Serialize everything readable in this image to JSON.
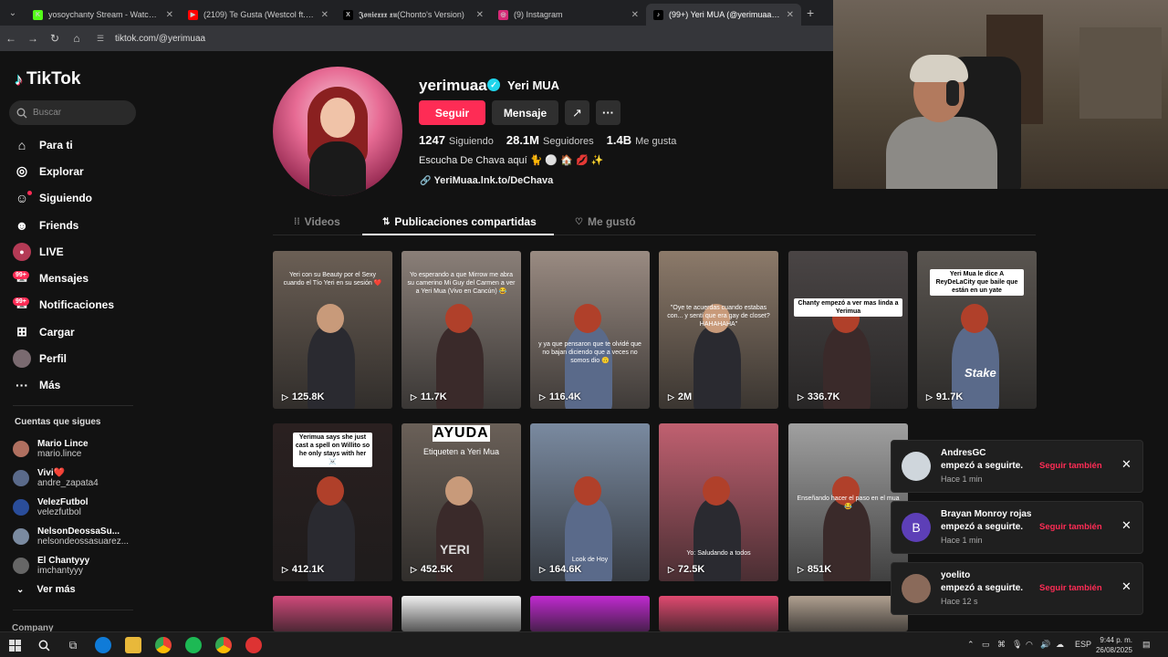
{
  "browser": {
    "tabs": [
      {
        "title": "yosoychanty Stream - Watch Li...",
        "favicon_color": "#53fc18",
        "favicon_text": "K"
      },
      {
        "title": "(2109) Te Gusta (Westcol ft. Le...",
        "favicon_color": "#ff0000",
        "favicon_text": "▶"
      },
      {
        "title": "𝕵𝖔𝖓𝖎𝖊𝖝𝖝𝖝 𝖝𝖚(Chonto's Version)",
        "favicon_color": "#000000",
        "favicon_text": "X"
      },
      {
        "title": "(9) Instagram",
        "favicon_color": "#d62976",
        "favicon_text": "◎"
      },
      {
        "title": "(99+) Yeri MUA (@yerimuaa) of...",
        "favicon_color": "#000000",
        "favicon_text": "♪"
      }
    ],
    "url": "tiktok.com/@yerimuaa"
  },
  "sidebar": {
    "logo": "TikTok",
    "search_placeholder": "Buscar",
    "items": [
      {
        "label": "Para ti",
        "icon": "home-icon",
        "glyph": "⌂"
      },
      {
        "label": "Explorar",
        "icon": "compass-icon",
        "glyph": "◎"
      },
      {
        "label": "Siguiendo",
        "icon": "following-icon",
        "glyph": "☺"
      },
      {
        "label": "Friends",
        "icon": "friends-icon",
        "glyph": "☻"
      },
      {
        "label": "LIVE",
        "icon": "live-icon",
        "glyph": "●"
      },
      {
        "label": "Mensajes",
        "icon": "messages-icon",
        "glyph": "✉",
        "badge": "99+"
      },
      {
        "label": "Notificaciones",
        "icon": "notifications-icon",
        "glyph": "✉",
        "badge": "99+"
      },
      {
        "label": "Cargar",
        "icon": "upload-icon",
        "glyph": "⊞"
      },
      {
        "label": "Perfil",
        "icon": "profile-icon",
        "glyph": "●"
      },
      {
        "label": "Más",
        "icon": "more-icon",
        "glyph": "···"
      }
    ],
    "follows_title": "Cuentas que sigues",
    "follows": [
      {
        "name": "Mario Lince",
        "user": "mario.lince",
        "color": "#b07060"
      },
      {
        "name": "Vivi❤️",
        "user": "andre_zapata4",
        "color": "#5a6a8a"
      },
      {
        "name": "VelezFutbol",
        "user": "velezfutbol",
        "color": "#2a4d9a"
      },
      {
        "name": "NelsonDeossaSu...",
        "user": "nelsondeossasuarez...",
        "color": "#7a8aa0"
      },
      {
        "name": "El Chantyyy",
        "user": "imchantyyy",
        "color": "#666666"
      }
    ],
    "see_more": "Ver más",
    "company": "Company"
  },
  "profile": {
    "username": "yerimuaa",
    "display_name": "Yeri MUA",
    "follow_label": "Seguir",
    "message_label": "Mensaje",
    "stats": [
      {
        "value": "1247",
        "label": "Siguiendo"
      },
      {
        "value": "28.1M",
        "label": "Seguidores"
      },
      {
        "value": "1.4B",
        "label": "Me gusta"
      }
    ],
    "bio": "Escucha De Chava aquí 🐈 ⚪ 🏠 💋 ✨",
    "link": "YeriMuaa.lnk.to/DeChava"
  },
  "tabs": [
    {
      "label": "Videos",
      "icon": "grid-icon",
      "glyph": "⁞⁞"
    },
    {
      "label": "Publicaciones compartidas",
      "icon": "repost-icon",
      "glyph": "⇅"
    },
    {
      "label": "Me gustó",
      "icon": "like-hidden-icon",
      "glyph": "♡"
    }
  ],
  "videos": [
    {
      "views": "125.8K",
      "bg": "#6b5f55",
      "caption": "Yeri con su Beauty por el Sexy cuando el Tío Yeri en su sesión ❤️"
    },
    {
      "views": "11.7K",
      "bg": "#8a7f78",
      "caption": "Yo esperando a que Mirrow me abra su camerino Mi Guy del Carmen a ver a Yeri Mua (Vivo en Cancún) 😂"
    },
    {
      "views": "116.4K",
      "bg": "#9a8b82",
      "caption": "y ya que pensaron que te olvidé que no bajan diciendo que a veces no somos dio 🙃"
    },
    {
      "views": "2M",
      "bg": "#8c7a6a",
      "caption": "\"Oye te acuerdas cuando estabas con... y sentí que era gay de closet? HAHAHAHA\""
    },
    {
      "views": "336.7K",
      "bg": "#4a4545",
      "caption": "Chanty empezó a ver mas linda a Yerimua"
    },
    {
      "views": "91.7K",
      "bg": "#5a5550",
      "caption": "Yeri Mua le dice A ReyDeLaCity que baile que están en un yate",
      "watermark": "Stake"
    },
    {
      "views": "412.1K",
      "bg": "#2a2020",
      "caption": "Yerimua says she just cast a spell on Willito so he only stays with her ☠️"
    },
    {
      "views": "452.5K",
      "bg": "#6a6058",
      "title": "AYUDA",
      "subtitle": "Etiqueten a Yeri Mua",
      "tag": "YERI"
    },
    {
      "views": "164.6K",
      "bg": "#7a8aa0",
      "caption": "Look de Hoy"
    },
    {
      "views": "72.5K",
      "bg": "#c06070",
      "caption": "Yo: Saludando a todos"
    },
    {
      "views": "851K",
      "bg": "#a0a0a0",
      "caption": "Enseñando hacer el paso en el mua 😂"
    },
    {
      "views": "",
      "bg": "#d04a7a"
    },
    {
      "views": "",
      "bg": "#f0f0f0"
    },
    {
      "views": "",
      "bg": "#c02ad0"
    },
    {
      "views": "",
      "bg": "#e04a70"
    },
    {
      "views": "",
      "bg": "#b0a090"
    }
  ],
  "notifications": [
    {
      "name": "AndresGC",
      "message": "empezó a seguirte.",
      "time": "Hace 1 min",
      "action": "Seguir también",
      "avatar_color": "#cfd6dc",
      "avatar_letter": ""
    },
    {
      "name": "Brayan Monroy rojas",
      "message": "empezó a seguirte.",
      "time": "Hace 1 min",
      "action": "Seguir también",
      "avatar_color": "#5d3fb7",
      "avatar_letter": "B"
    },
    {
      "name": "yoelito",
      "message": "empezó a seguirte.",
      "time": "Hace 12 s",
      "action": "Seguir también",
      "avatar_color": "#8a6a5a",
      "avatar_letter": ""
    }
  ],
  "taskbar": {
    "language": "ESP",
    "time": "9:44 p. m.",
    "date": "26/08/2025"
  },
  "colors": {
    "accent": "#fe2c55",
    "verified": "#20d5ec",
    "background": "#121212"
  }
}
